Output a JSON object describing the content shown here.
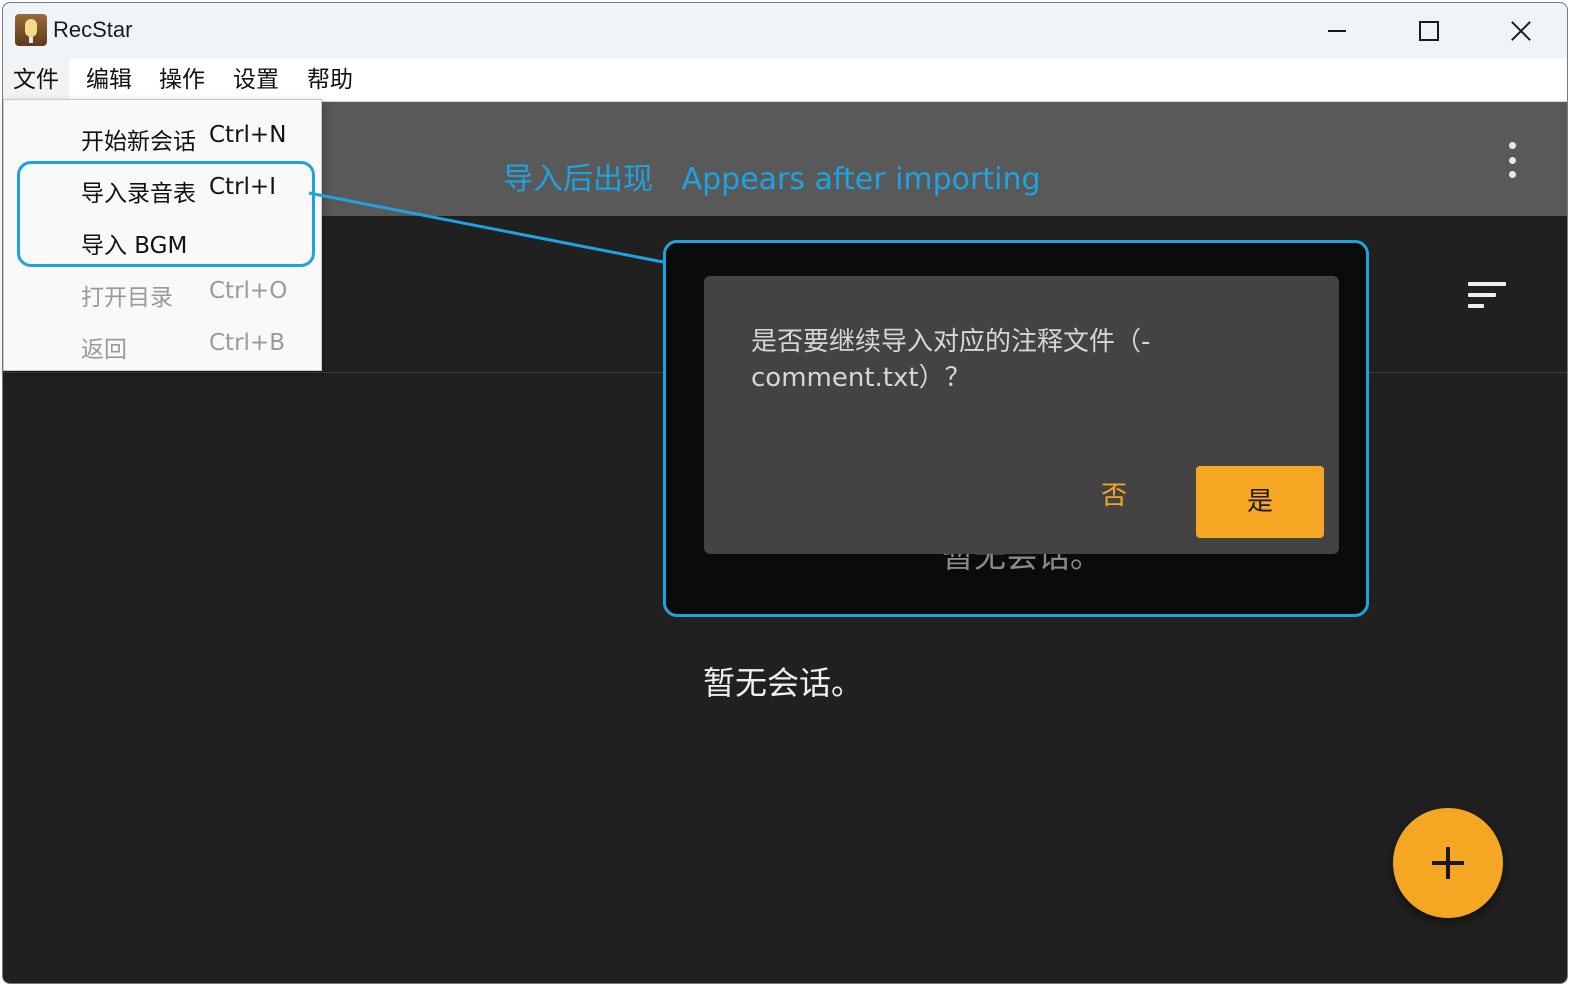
{
  "window": {
    "title": "RecStar"
  },
  "menubar": {
    "items": [
      {
        "label": "文件"
      },
      {
        "label": "编辑"
      },
      {
        "label": "操作"
      },
      {
        "label": "设置"
      },
      {
        "label": "帮助"
      }
    ]
  },
  "file_menu": {
    "items": [
      {
        "label": "开始新会话",
        "shortcut": "Ctrl+N",
        "enabled": true
      },
      {
        "label": "导入录音表",
        "shortcut": "Ctrl+I",
        "enabled": true
      },
      {
        "label": "导入 BGM",
        "shortcut": "",
        "enabled": true
      },
      {
        "label": "打开目录",
        "shortcut": "Ctrl+O",
        "enabled": false
      },
      {
        "label": "返回",
        "shortcut": "Ctrl+B",
        "enabled": false
      }
    ]
  },
  "header": {
    "annotation": "导入后出现   Appears after importing"
  },
  "main": {
    "empty_text": "暂无会话。",
    "ghost_text": "暂无会话。"
  },
  "dialog": {
    "message": "是否要继续导入对应的注释文件（-comment.txt）？",
    "no_label": "否",
    "yes_label": "是"
  },
  "colors": {
    "accent": "#f5a623",
    "callout": "#1ea3e0",
    "background": "#202020",
    "header": "#595959"
  },
  "icons": {
    "app": "recstar-mic-icon",
    "minimize": "minimize-icon",
    "maximize": "maximize-icon",
    "close": "close-icon",
    "more": "more-vertical-icon",
    "sort": "sort-icon",
    "add": "plus-icon"
  }
}
